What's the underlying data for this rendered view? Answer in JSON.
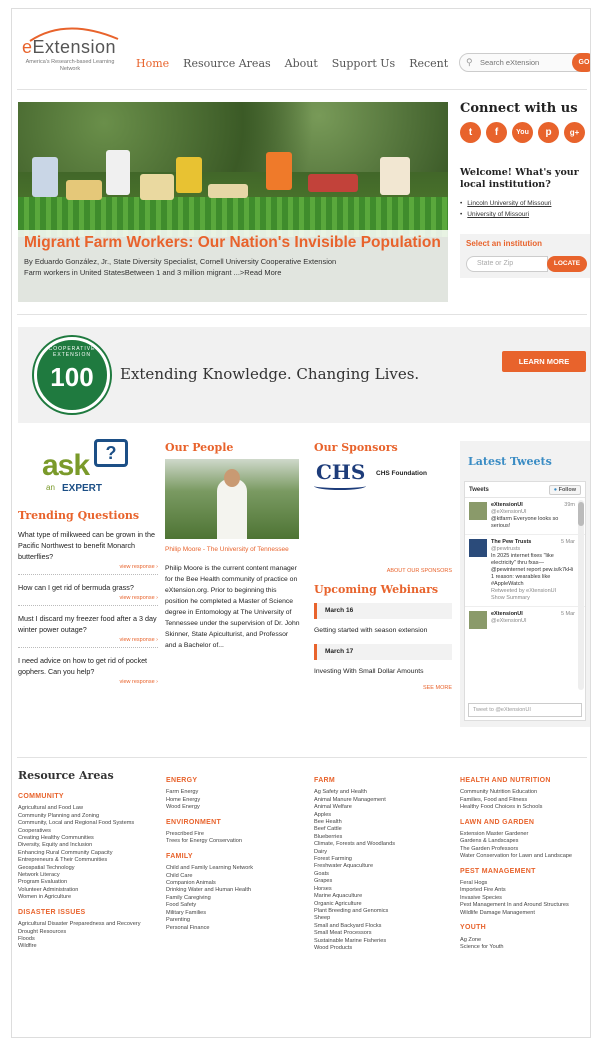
{
  "header": {
    "logo_word": "Extension",
    "logo_tagline": "America's Research-based Learning Network",
    "nav": [
      "Home",
      "Resource Areas",
      "About",
      "Support Us",
      "Recent"
    ],
    "search_placeholder": "Search eXtension",
    "search_button": "GO"
  },
  "hero": {
    "title": "Migrant Farm Workers: Our Nation's Invisible Population",
    "byline": "By Eduardo González, Jr., State Diversity Specialist, Cornell University Cooperative Extension",
    "teaser": "Farm workers in United StatesBetween 1 and 3 million migrant ...>Read More"
  },
  "connect": {
    "title": "Connect with us",
    "icons": [
      "twitter-icon",
      "facebook-icon",
      "youtube-icon",
      "pinterest-icon",
      "googleplus-icon"
    ],
    "icon_glyphs": [
      "t",
      "f",
      "You",
      "p",
      "g+"
    ],
    "welcome": "Welcome! What's your local institution?",
    "institutions": [
      "Lincoln University of Missouri",
      "University of Missouri"
    ],
    "select_label": "Select an institution",
    "zip_placeholder": "State or Zip",
    "locate_button": "LOCATE"
  },
  "banner": {
    "seal_number": "100",
    "seal_text": "COOPERATIVE EXTENSION",
    "motto": "Extending Knowledge. Changing Lives.",
    "button": "LEARN MORE"
  },
  "ask": {
    "word": "ask",
    "an": "an",
    "expert": "EXPERT",
    "bubble": "?"
  },
  "trending": {
    "title": "Trending Questions",
    "view_label": "view response ›",
    "questions": [
      "What type of milkweed can be grown in the Pacific Northwest to benefit Monarch butterflies?",
      "How can I get rid of bermuda grass?",
      "Must I discard my freezer food after a 3 day winter power outage?",
      "I need advice on how to get rid of pocket gophers. Can you help?"
    ]
  },
  "people": {
    "title": "Our People",
    "name": "Philip Moore - The University of Tennessee",
    "bio": "Philip Moore is the current content manager for the Bee Health community of practice on eXtension.org. Prior to beginning this position he completed a Master of Science degree in Entomology at The University of Tennessee under the supervision of Dr. John Skinner, State Apiculturist, and Professor and a Bachelor of..."
  },
  "sponsors": {
    "title": "Our Sponsors",
    "logo": "CHS",
    "foundation": "CHS Foundation",
    "about_link": "ABOUT OUR SPONSORS"
  },
  "webinars": {
    "title": "Upcoming Webinars",
    "items": [
      {
        "date": "March 16",
        "title": "Getting started with season extension"
      },
      {
        "date": "March 17",
        "title": "Investing With Small Dollar Amounts"
      }
    ],
    "see_more": "SEE MORE"
  },
  "tweets": {
    "title": "Latest Tweets",
    "header": "Tweets",
    "follow": "Follow",
    "items": [
      {
        "name": "eXtensionUI",
        "handle": "@eXtensionUI",
        "date": "39m",
        "text": "@ktfarm Everyone looks so serious!"
      },
      {
        "name": "The Pew Trusts",
        "handle": "@pewtrusts",
        "date": "5 Mar",
        "text": "In 2025 internet fixes \"like electricity\" thru fxas— @pewinternet report pew.is/k7kHi 1 reason: wearables like #AppleWatch",
        "retweet": "Retweeted by eXtensionUI",
        "summary": "Show Summary"
      },
      {
        "name": "eXtensionUI",
        "handle": "@eXtensionUI",
        "date": "5 Mar",
        "text": ""
      }
    ],
    "tweet_to": "Tweet to @eXtensionUI"
  },
  "resource_areas": {
    "title": "Resource Areas",
    "columns": [
      [
        {
          "cat": "COMMUNITY",
          "items": [
            "Agricultural and Food Law",
            "Community Planning and Zoning",
            "Community, Local and Regional Food Systems",
            "Cooperatives",
            "Creating Healthy Communities",
            "Diversity, Equity and Inclusion",
            "Enhancing Rural Community Capacity",
            "Entrepreneurs & Their Communities",
            "Geospatial Technology",
            "Network Literacy",
            "Program Evaluation",
            "Volunteer Administration",
            "Women in Agriculture"
          ]
        },
        {
          "cat": "DISASTER ISSUES",
          "items": [
            "Agricultural Disaster Preparedness and Recovery",
            "Drought Resources",
            "Floods",
            "Wildfire"
          ]
        }
      ],
      [
        {
          "cat": "ENERGY",
          "items": [
            "Farm Energy",
            "Home Energy",
            "Wood Energy"
          ]
        },
        {
          "cat": "ENVIRONMENT",
          "items": [
            "Prescribed Fire",
            "Trees for Energy Conservation"
          ]
        },
        {
          "cat": "FAMILY",
          "items": [
            "Child and Family Learning Network",
            "Child Care",
            "Companion Animals",
            "Drinking Water and Human Health",
            "Family Caregiving",
            "Food Safety",
            "Military Families",
            "Parenting",
            "Personal Finance"
          ]
        }
      ],
      [
        {
          "cat": "FARM",
          "items": [
            "Ag Safety and Health",
            "Animal Manure Management",
            "Animal Welfare",
            "Apples",
            "Bee Health",
            "Beef Cattle",
            "Blueberries",
            "Climate, Forests and Woodlands",
            "Dairy",
            "Forest Farming",
            "Freshwater Aquaculture",
            "Goats",
            "Grapes",
            "Horses",
            "Marine Aquaculture",
            "Organic Agriculture",
            "Plant Breeding and Genomics",
            "Sheep",
            "Small and Backyard Flocks",
            "Small Meat Processors",
            "Sustainable Marine Fisheries",
            "Wood Products"
          ]
        }
      ],
      [
        {
          "cat": "HEALTH AND NUTRITION",
          "items": [
            "Community Nutrition Education",
            "Families, Food and Fitness",
            "Healthy Food Choices in Schools"
          ]
        },
        {
          "cat": "LAWN AND GARDEN",
          "items": [
            "Extension Master Gardener",
            "Gardens & Landscapes",
            "The Garden Professors",
            "Water Conservation for Lawn and Landscape"
          ]
        },
        {
          "cat": "PEST MANAGEMENT",
          "items": [
            "Feral Hogs",
            "Imported Fire Ants",
            "Invasive Species",
            "Pest Management In and Around Structures",
            "Wildlife Damage Management"
          ]
        },
        {
          "cat": "YOUTH",
          "items": [
            "Ag Zone",
            "Science for Youth"
          ]
        }
      ]
    ]
  }
}
